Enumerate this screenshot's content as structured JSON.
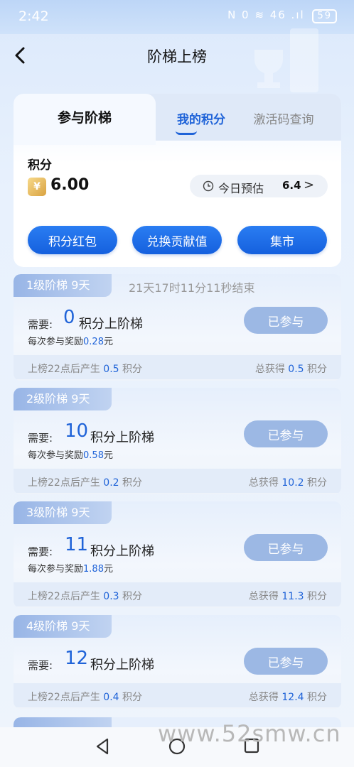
{
  "status": {
    "time": "2:42",
    "icons_text": "N 0 ≋ 46 .ıl",
    "battery": "59"
  },
  "header": {
    "title": "阶梯上榜"
  },
  "tabs": [
    {
      "label": "参与阶梯"
    },
    {
      "label": "我的积分"
    },
    {
      "label": "激活码查询"
    }
  ],
  "points": {
    "label": "积分",
    "value": "6.00",
    "estimate_label": "今日预估",
    "estimate_value": "6.4",
    "estimate_arrow": ">"
  },
  "actions": [
    {
      "label": "积分红包"
    },
    {
      "label": "兑换贡献值"
    },
    {
      "label": "集市"
    }
  ],
  "levels": [
    {
      "badge": "1级阶梯  9天",
      "countdown": "21天17时11分11秒结束",
      "need_label": "需要:",
      "need_num": "0",
      "need_text": "积分上阶梯",
      "reward_prefix": "每次参与奖励",
      "reward_value": "0.28",
      "reward_unit": "元",
      "button": "已参与",
      "footer_left_prefix": "上榜22点后产生",
      "footer_left_value": "0.5",
      "footer_left_unit": "积分",
      "footer_right_prefix": "总获得",
      "footer_right_value": "0.5",
      "footer_right_unit": "积分"
    },
    {
      "badge": "2级阶梯  9天",
      "countdown": "",
      "need_label": "需要:",
      "need_num": "10",
      "need_text": "积分上阶梯",
      "reward_prefix": "每次参与奖励",
      "reward_value": "0.58",
      "reward_unit": "元",
      "button": "已参与",
      "footer_left_prefix": "上榜22点后产生",
      "footer_left_value": "0.2",
      "footer_left_unit": "积分",
      "footer_right_prefix": "总获得",
      "footer_right_value": "10.2",
      "footer_right_unit": "积分"
    },
    {
      "badge": "3级阶梯  9天",
      "countdown": "",
      "need_label": "需要:",
      "need_num": "11",
      "need_text": "积分上阶梯",
      "reward_prefix": "每次参与奖励",
      "reward_value": "1.88",
      "reward_unit": "元",
      "button": "已参与",
      "footer_left_prefix": "上榜22点后产生",
      "footer_left_value": "0.3",
      "footer_left_unit": "积分",
      "footer_right_prefix": "总获得",
      "footer_right_value": "11.3",
      "footer_right_unit": "积分"
    },
    {
      "badge": "4级阶梯  9天",
      "countdown": "",
      "need_label": "需要:",
      "need_num": "12",
      "need_text": "积分上阶梯",
      "reward_prefix": "",
      "reward_value": "",
      "reward_unit": "",
      "button": "已参与",
      "footer_left_prefix": "上榜22点后产生",
      "footer_left_value": "0.4",
      "footer_left_unit": "积分",
      "footer_right_prefix": "总获得",
      "footer_right_value": "12.4",
      "footer_right_unit": "积分"
    }
  ],
  "watermark": "www.52smw.cn"
}
